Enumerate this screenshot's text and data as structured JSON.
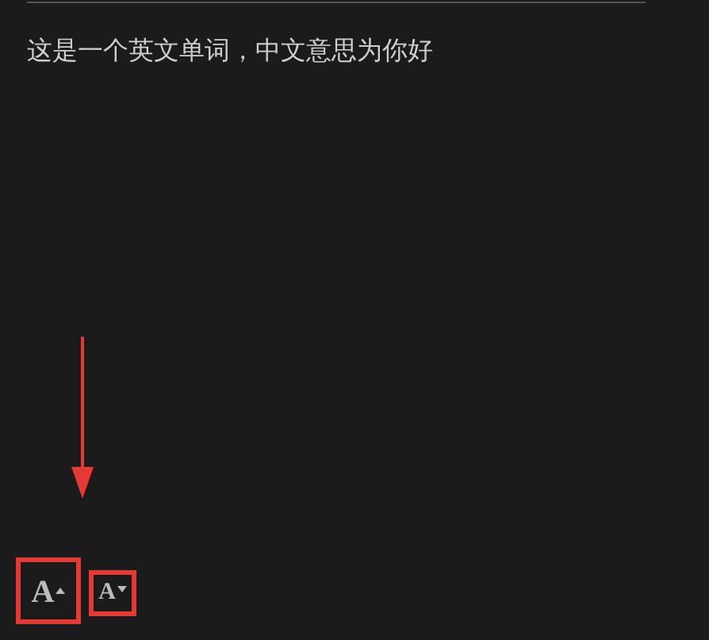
{
  "content": {
    "text": "这是一个英文单词，中文意思为你好"
  },
  "font_buttons": [
    {
      "kind": "increase",
      "label": "A"
    },
    {
      "kind": "decrease",
      "label": "A"
    }
  ]
}
